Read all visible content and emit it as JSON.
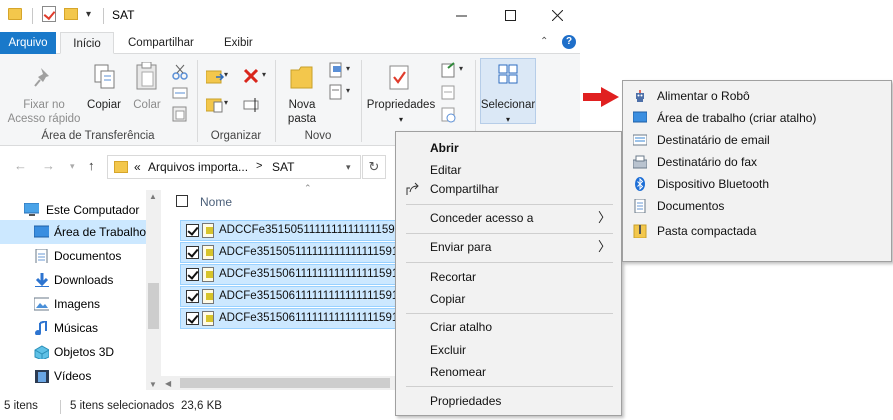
{
  "window": {
    "title": "SAT",
    "minimize_icon": "minimize-icon",
    "maximize_icon": "maximize-icon",
    "close_icon": "close-icon"
  },
  "tabs": [
    {
      "label": "Arquivo"
    },
    {
      "label": "Início"
    },
    {
      "label": "Compartilhar"
    },
    {
      "label": "Exibir"
    }
  ],
  "ribbon": {
    "clipboard": {
      "pin_label": "Fixar no Acesso rápido",
      "copy_label": "Copiar",
      "paste_label": "Colar",
      "group_label": "Área de Transferência"
    },
    "organize": {
      "group_label": "Organizar"
    },
    "new": {
      "new_folder_label": "Nova pasta",
      "group_label": "Novo"
    },
    "open": {
      "properties_label": "Propriedades"
    },
    "select": {
      "select_label": "Selecionar"
    }
  },
  "address": {
    "prefix": "«",
    "segments": [
      "Arquivos importa...",
      "SAT"
    ],
    "separator": ">"
  },
  "nav_pane": {
    "items": [
      {
        "label": "Este Computador",
        "icon": "computer-icon"
      },
      {
        "label": "Área de Trabalho",
        "icon": "desktop-icon",
        "selected": true
      },
      {
        "label": "Documentos",
        "icon": "documents-icon"
      },
      {
        "label": "Downloads",
        "icon": "downloads-icon"
      },
      {
        "label": "Imagens",
        "icon": "pictures-icon"
      },
      {
        "label": "Músicas",
        "icon": "music-icon"
      },
      {
        "label": "Objetos 3D",
        "icon": "3d-objects-icon"
      },
      {
        "label": "Vídeos",
        "icon": "videos-icon"
      }
    ]
  },
  "file_list": {
    "column_name": "Nome",
    "files": [
      "ADCCFe35150511111111111111591",
      "ADCFe351505111111111111111591",
      "ADCFe351506111111111111111591",
      "ADCFe351506111111111111111591",
      "ADCFe351506111111111111111591"
    ]
  },
  "status": {
    "item_count": "5 itens",
    "selected_count": "5 itens selecionados",
    "size": "23,6 KB"
  },
  "context_menu": {
    "items": [
      {
        "label": "Abrir",
        "bold": true
      },
      {
        "label": "Editar"
      },
      {
        "label": "Compartilhar",
        "icon": "share-icon"
      },
      {
        "label": "Conceder acesso a",
        "submenu": true
      },
      {
        "label": "Enviar para",
        "submenu": true
      },
      {
        "label": "Recortar"
      },
      {
        "label": "Copiar"
      },
      {
        "label": "Criar atalho"
      },
      {
        "label": "Excluir"
      },
      {
        "label": "Renomear"
      },
      {
        "label": "Propriedades"
      }
    ]
  },
  "send_to_menu": {
    "items": [
      {
        "label": "Alimentar o Robô",
        "icon": "robot-icon"
      },
      {
        "label": "Área de trabalho (criar atalho)",
        "icon": "desktop-icon"
      },
      {
        "label": "Destinatário de email",
        "icon": "mail-icon"
      },
      {
        "label": "Destinatário do fax",
        "icon": "fax-icon"
      },
      {
        "label": "Dispositivo Bluetooth",
        "icon": "bluetooth-icon"
      },
      {
        "label": "Documentos",
        "icon": "documents-icon"
      },
      {
        "label": "Pasta compactada",
        "icon": "zip-folder-icon"
      }
    ]
  },
  "colors": {
    "accent": "#1979ca",
    "selection": "#cce8ff",
    "pointer_arrow": "#e02020"
  }
}
